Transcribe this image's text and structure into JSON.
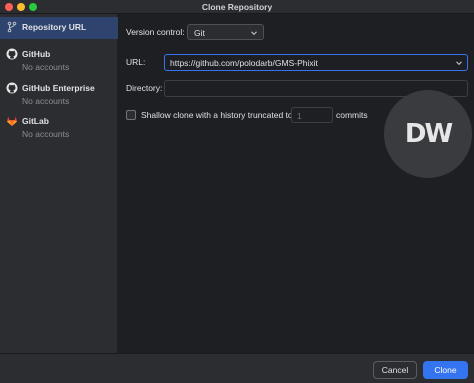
{
  "window": {
    "title": "Clone Repository"
  },
  "sidebar": {
    "items": [
      {
        "label": "Repository URL",
        "sublabel": "",
        "icon": "vcs-branch-icon",
        "selected": true
      },
      {
        "label": "GitHub",
        "sublabel": "No accounts",
        "icon": "github-icon",
        "selected": false
      },
      {
        "label": "GitHub Enterprise",
        "sublabel": "No accounts",
        "icon": "github-icon",
        "selected": false
      },
      {
        "label": "GitLab",
        "sublabel": "No accounts",
        "icon": "gitlab-icon",
        "selected": false
      }
    ]
  },
  "form": {
    "version_control_label": "Version control:",
    "version_control_value": "Git",
    "url_label": "URL:",
    "url_value": "https://github.com/polodarb/GMS-Phixit",
    "directory_label": "Directory:",
    "directory_value": "",
    "shallow_label": "Shallow clone with a history truncated to",
    "shallow_checked": false,
    "shallow_count": "1",
    "commits_label": "commits"
  },
  "watermark": {
    "text": "DW"
  },
  "footer": {
    "cancel_label": "Cancel",
    "clone_label": "Clone"
  },
  "colors": {
    "accent": "#3574f0",
    "selection": "#2e436e",
    "background": "#1e1f22",
    "panel": "#2b2d30",
    "gitlab": "#e24329"
  }
}
